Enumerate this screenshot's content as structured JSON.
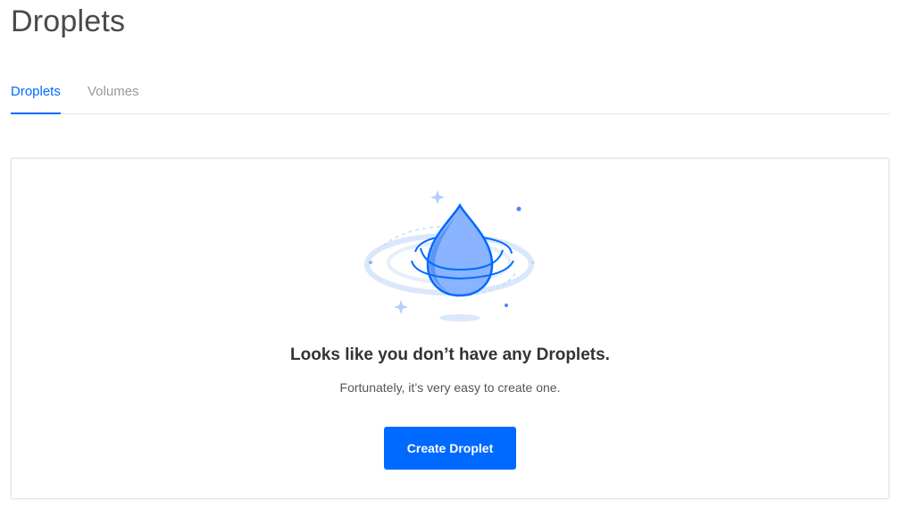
{
  "page": {
    "title": "Droplets"
  },
  "tabs": [
    {
      "label": "Droplets",
      "active": true
    },
    {
      "label": "Volumes",
      "active": false
    }
  ],
  "empty_state": {
    "illustration_icon": "droplet-icon",
    "heading": "Looks like you don’t have any Droplets.",
    "subtext": "Fortunately, it’s very easy to create one.",
    "button_label": "Create Droplet"
  },
  "colors": {
    "accent": "#0069ff",
    "illustration_fill": "#8ab4ff",
    "illustration_light": "#dbe7fb"
  }
}
